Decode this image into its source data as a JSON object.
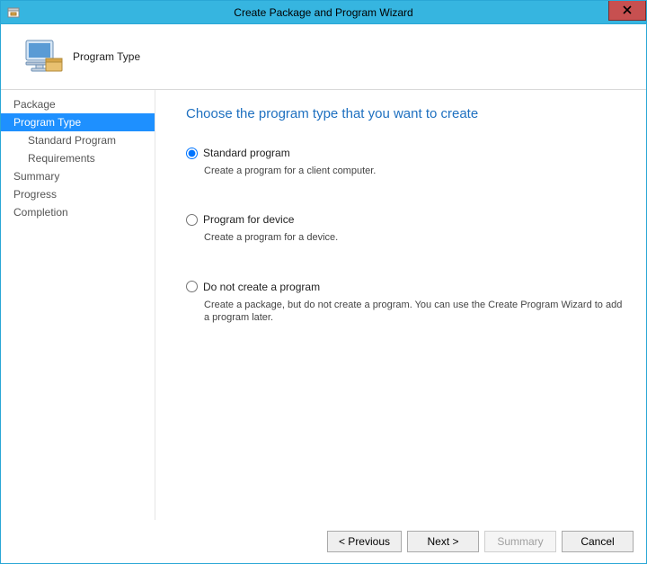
{
  "window": {
    "title": "Create Package and Program Wizard"
  },
  "header": {
    "title": "Program Type"
  },
  "sidebar": {
    "items": [
      {
        "label": "Package",
        "selected": false,
        "sub": false
      },
      {
        "label": "Program Type",
        "selected": true,
        "sub": false
      },
      {
        "label": "Standard Program",
        "selected": false,
        "sub": true
      },
      {
        "label": "Requirements",
        "selected": false,
        "sub": true
      },
      {
        "label": "Summary",
        "selected": false,
        "sub": false
      },
      {
        "label": "Progress",
        "selected": false,
        "sub": false
      },
      {
        "label": "Completion",
        "selected": false,
        "sub": false
      }
    ]
  },
  "content": {
    "heading": "Choose the program type that you want to create",
    "options": [
      {
        "label": "Standard program",
        "desc": "Create a program for a client computer.",
        "checked": true
      },
      {
        "label": "Program for device",
        "desc": "Create a program for a device.",
        "checked": false
      },
      {
        "label": "Do not create a program",
        "desc": "Create a package, but do not create a program. You can use the Create Program Wizard to add a program later.",
        "checked": false
      }
    ]
  },
  "footer": {
    "previous": "< Previous",
    "next": "Next >",
    "summary": "Summary",
    "cancel": "Cancel"
  }
}
